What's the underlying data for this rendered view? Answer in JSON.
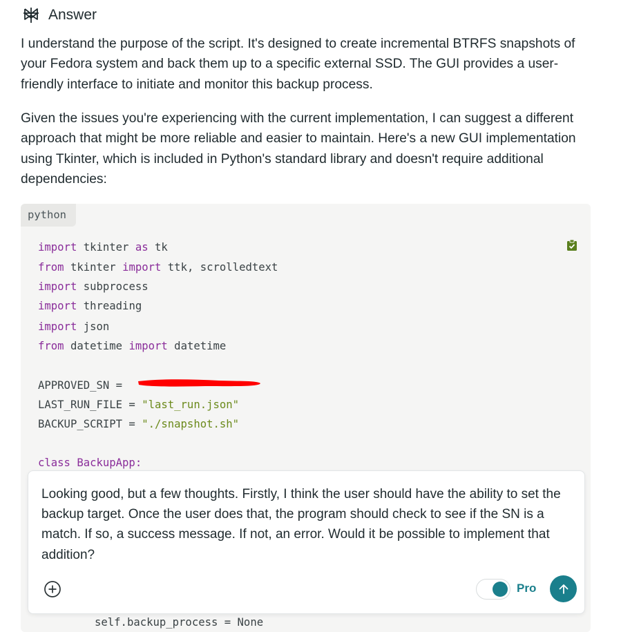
{
  "header": {
    "title": "Answer",
    "icon": "perplexity-logo-icon"
  },
  "paragraphs": [
    "I understand the purpose of the script. It's designed to create incremental BTRFS snapshots of your Fedora system and back them up to a specific external SSD. The GUI provides a user-friendly interface to initiate and monitor this backup process.",
    "Given the issues you're experiencing with the current implementation, I can suggest a different approach that might be more reliable and easier to maintain. Here's a new GUI implementation using Tkinter, which is included in Python's standard library and doesn't require additional dependencies:"
  ],
  "code": {
    "language": "python",
    "copy_icon": "clipboard-check-icon",
    "lines": {
      "l1_kw1": "import",
      "l1_rest": " tkinter ",
      "l1_kw2": "as",
      "l1_end": " tk",
      "l2_kw1": "from",
      "l2_rest": " tkinter ",
      "l2_kw2": "import",
      "l2_end": " ttk, scrolledtext",
      "l3_kw": "import",
      "l3_rest": " subprocess",
      "l4_kw": "import",
      "l4_rest": " threading",
      "l5_kw": "import",
      "l5_rest": " json",
      "l6_kw1": "from",
      "l6_rest": " datetime ",
      "l6_kw2": "import",
      "l6_end": " datetime",
      "l7": "APPROVED_SN = ",
      "l8_var": "LAST_RUN_FILE = ",
      "l8_str": "\"last_run.json\"",
      "l9_var": "BACKUP_SCRIPT = ",
      "l9_str": "\"./snapshot.sh\"",
      "l10": "class BackupApp:",
      "last": "self.backup_process = None"
    },
    "redaction_color": "#ff0000"
  },
  "composer": {
    "text": "Looking good, but a few thoughts. Firstly, I think the user should have the ability to set the backup target. Once the user does that, the program should check to see if the SN is a match. If so, a success message. If not, an error. Would it be possible to implement that addition?",
    "attach_icon": "plus-circle-icon",
    "pro_label": "Pro",
    "pro_enabled": true,
    "send_icon": "arrow-up-icon",
    "accent": "#1a7f8c"
  }
}
